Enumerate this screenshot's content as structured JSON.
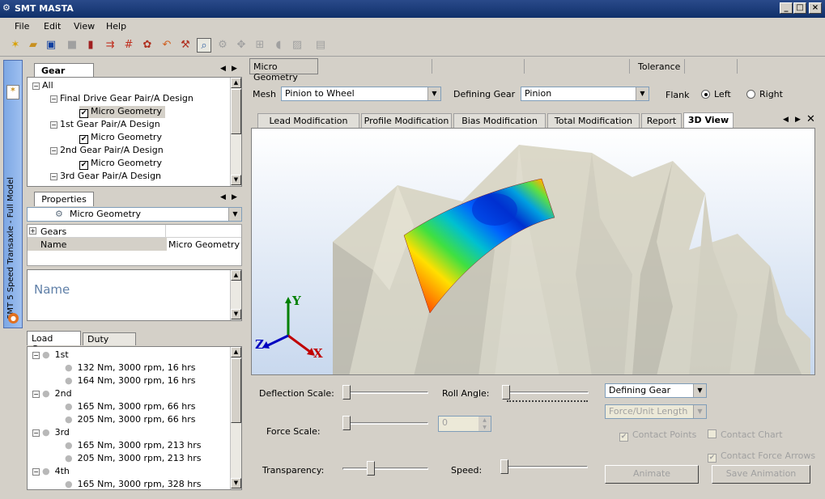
{
  "window": {
    "title": "SMT MASTA"
  },
  "menu": [
    "File",
    "Edit",
    "View",
    "Help"
  ],
  "side_tab": {
    "label": "SMT 5 Speed Transaxle - Full Model"
  },
  "gear_sets": {
    "tab_label": "Gear Sets",
    "items": [
      {
        "label": "All",
        "type": "root"
      },
      {
        "label": "Final Drive Gear Pair/A Design",
        "type": "group"
      },
      {
        "label": "Micro Geometry",
        "type": "check",
        "selected": true
      },
      {
        "label": "1st Gear Pair/A Design",
        "type": "group"
      },
      {
        "label": "Micro Geometry",
        "type": "check"
      },
      {
        "label": "2nd Gear Pair/A Design",
        "type": "group"
      },
      {
        "label": "Micro Geometry",
        "type": "check"
      },
      {
        "label": "3rd Gear Pair/A Design",
        "type": "group"
      }
    ]
  },
  "properties": {
    "tab_label": "Properties",
    "selector_value": "Micro Geometry",
    "rows": [
      {
        "name": "Gears",
        "value": ""
      },
      {
        "name": "Name",
        "value": "Micro Geometry"
      }
    ],
    "description_title": "Name"
  },
  "load_cases": {
    "tabs": [
      "Load Cases",
      "Duty Cycles"
    ],
    "items": [
      {
        "label": "1st",
        "level": 0
      },
      {
        "label": "132 Nm, 3000 rpm, 16 hrs",
        "level": 1
      },
      {
        "label": "164 Nm, 3000 rpm, 16 hrs",
        "level": 1
      },
      {
        "label": "2nd",
        "level": 0
      },
      {
        "label": "165 Nm, 3000 rpm, 66 hrs",
        "level": 1
      },
      {
        "label": "205 Nm, 3000 rpm, 66 hrs",
        "level": 1
      },
      {
        "label": "3rd",
        "level": 0
      },
      {
        "label": "165 Nm, 3000 rpm, 213 hrs",
        "level": 1
      },
      {
        "label": "205 Nm, 3000 rpm, 213 hrs",
        "level": 1
      },
      {
        "label": "4th",
        "level": 0
      },
      {
        "label": "165 Nm, 3000 rpm, 328 hrs",
        "level": 1
      }
    ]
  },
  "top_tabs": {
    "active": "Micro Geometry",
    "right": "Tolerance"
  },
  "mesh": {
    "mesh_label": "Mesh",
    "mesh_value": "Pinion to Wheel",
    "defining_gear_label": "Defining Gear",
    "defining_gear_value": "Pinion",
    "flank_label": "Flank",
    "flank_left": "Left",
    "flank_right": "Right",
    "flank_selected": "Left"
  },
  "view_tabs": [
    "Lead Modification",
    "Profile Modification",
    "Bias Modification",
    "Total Modification",
    "Report",
    "3D View"
  ],
  "active_view_tab": "3D View",
  "axes": {
    "x": "X",
    "y": "Y",
    "z": "Z"
  },
  "controls": {
    "deflection_scale_label": "Deflection Scale:",
    "roll_angle_label": "Roll Angle:",
    "force_scale_label": "Force Scale:",
    "force_value": "0",
    "transparency_label": "Transparency:",
    "speed_label": "Speed:",
    "gear_select_value": "Defining Gear",
    "force_unit_value": "Force/Unit Length",
    "contact_points_label": "Contact Points",
    "contact_chart_label": "Contact Chart",
    "contact_force_arrows_label": "Contact Force Arrows",
    "animate_label": "Animate",
    "save_animation_label": "Save Animation"
  },
  "colors": {
    "title_bar": "#10306a",
    "side_tab": "#9ec0f0",
    "surface_hot": "#ff0000",
    "surface_cold": "#0040ff"
  }
}
